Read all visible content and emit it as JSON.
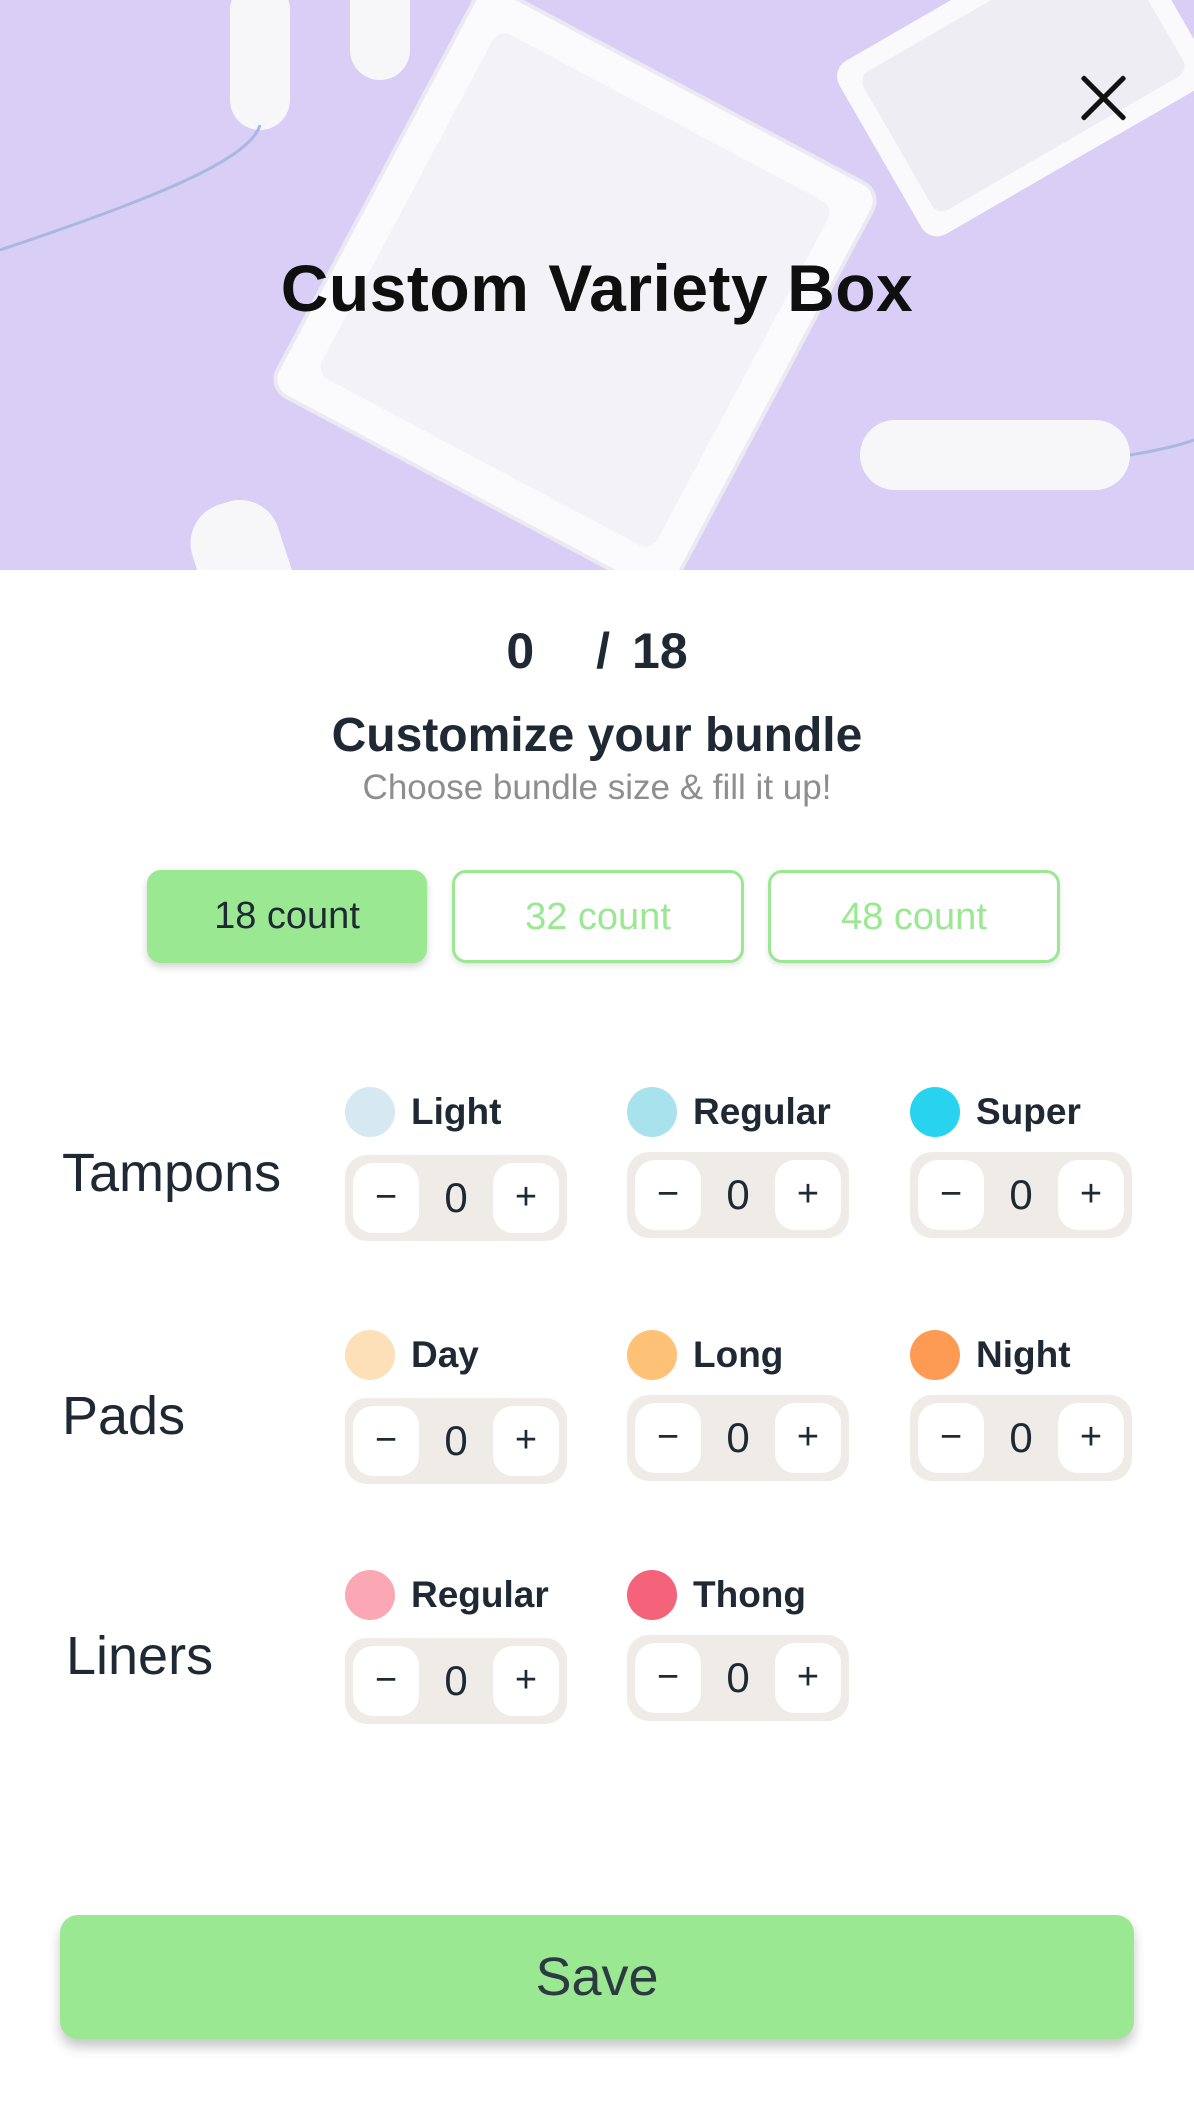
{
  "hero": {
    "title": "Custom Variety Box"
  },
  "counter": {
    "current": "0",
    "separator": "/",
    "total": "18"
  },
  "bundle": {
    "heading": "Customize your bundle",
    "subheading": "Choose bundle size & fill it up!",
    "sizes": [
      {
        "label": "18 count",
        "selected": true
      },
      {
        "label": "32 count",
        "selected": false
      },
      {
        "label": "48 count",
        "selected": false
      }
    ]
  },
  "stepper_symbols": {
    "minus": "−",
    "plus": "+"
  },
  "categories": [
    {
      "name": "Tampons",
      "variants": [
        {
          "label": "Light",
          "color": "#d6e8f2",
          "quantity": "0"
        },
        {
          "label": "Regular",
          "color": "#a8e2ec",
          "quantity": "0"
        },
        {
          "label": "Super",
          "color": "#27d3ef",
          "quantity": "0"
        }
      ]
    },
    {
      "name": "Pads",
      "variants": [
        {
          "label": "Day",
          "color": "#fde0b8",
          "quantity": "0"
        },
        {
          "label": "Long",
          "color": "#fdc275",
          "quantity": "0"
        },
        {
          "label": "Night",
          "color": "#fd9a54",
          "quantity": "0"
        }
      ]
    },
    {
      "name": "Liners",
      "variants": [
        {
          "label": "Regular",
          "color": "#fca8b4",
          "quantity": "0"
        },
        {
          "label": "Thong",
          "color": "#f4637a",
          "quantity": "0"
        }
      ]
    }
  ],
  "actions": {
    "save_label": "Save"
  },
  "colors": {
    "accent": "#9ae891",
    "hero_bg": "#d7cdf5"
  }
}
